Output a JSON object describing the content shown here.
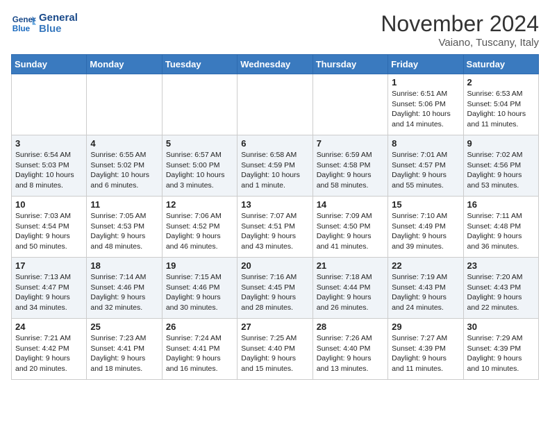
{
  "header": {
    "logo_line1": "General",
    "logo_line2": "Blue",
    "month": "November 2024",
    "location": "Vaiano, Tuscany, Italy"
  },
  "days_of_week": [
    "Sunday",
    "Monday",
    "Tuesday",
    "Wednesday",
    "Thursday",
    "Friday",
    "Saturday"
  ],
  "weeks": [
    [
      {
        "day": "",
        "info": ""
      },
      {
        "day": "",
        "info": ""
      },
      {
        "day": "",
        "info": ""
      },
      {
        "day": "",
        "info": ""
      },
      {
        "day": "",
        "info": ""
      },
      {
        "day": "1",
        "info": "Sunrise: 6:51 AM\nSunset: 5:06 PM\nDaylight: 10 hours\nand 14 minutes."
      },
      {
        "day": "2",
        "info": "Sunrise: 6:53 AM\nSunset: 5:04 PM\nDaylight: 10 hours\nand 11 minutes."
      }
    ],
    [
      {
        "day": "3",
        "info": "Sunrise: 6:54 AM\nSunset: 5:03 PM\nDaylight: 10 hours\nand 8 minutes."
      },
      {
        "day": "4",
        "info": "Sunrise: 6:55 AM\nSunset: 5:02 PM\nDaylight: 10 hours\nand 6 minutes."
      },
      {
        "day": "5",
        "info": "Sunrise: 6:57 AM\nSunset: 5:00 PM\nDaylight: 10 hours\nand 3 minutes."
      },
      {
        "day": "6",
        "info": "Sunrise: 6:58 AM\nSunset: 4:59 PM\nDaylight: 10 hours\nand 1 minute."
      },
      {
        "day": "7",
        "info": "Sunrise: 6:59 AM\nSunset: 4:58 PM\nDaylight: 9 hours\nand 58 minutes."
      },
      {
        "day": "8",
        "info": "Sunrise: 7:01 AM\nSunset: 4:57 PM\nDaylight: 9 hours\nand 55 minutes."
      },
      {
        "day": "9",
        "info": "Sunrise: 7:02 AM\nSunset: 4:56 PM\nDaylight: 9 hours\nand 53 minutes."
      }
    ],
    [
      {
        "day": "10",
        "info": "Sunrise: 7:03 AM\nSunset: 4:54 PM\nDaylight: 9 hours\nand 50 minutes."
      },
      {
        "day": "11",
        "info": "Sunrise: 7:05 AM\nSunset: 4:53 PM\nDaylight: 9 hours\nand 48 minutes."
      },
      {
        "day": "12",
        "info": "Sunrise: 7:06 AM\nSunset: 4:52 PM\nDaylight: 9 hours\nand 46 minutes."
      },
      {
        "day": "13",
        "info": "Sunrise: 7:07 AM\nSunset: 4:51 PM\nDaylight: 9 hours\nand 43 minutes."
      },
      {
        "day": "14",
        "info": "Sunrise: 7:09 AM\nSunset: 4:50 PM\nDaylight: 9 hours\nand 41 minutes."
      },
      {
        "day": "15",
        "info": "Sunrise: 7:10 AM\nSunset: 4:49 PM\nDaylight: 9 hours\nand 39 minutes."
      },
      {
        "day": "16",
        "info": "Sunrise: 7:11 AM\nSunset: 4:48 PM\nDaylight: 9 hours\nand 36 minutes."
      }
    ],
    [
      {
        "day": "17",
        "info": "Sunrise: 7:13 AM\nSunset: 4:47 PM\nDaylight: 9 hours\nand 34 minutes."
      },
      {
        "day": "18",
        "info": "Sunrise: 7:14 AM\nSunset: 4:46 PM\nDaylight: 9 hours\nand 32 minutes."
      },
      {
        "day": "19",
        "info": "Sunrise: 7:15 AM\nSunset: 4:46 PM\nDaylight: 9 hours\nand 30 minutes."
      },
      {
        "day": "20",
        "info": "Sunrise: 7:16 AM\nSunset: 4:45 PM\nDaylight: 9 hours\nand 28 minutes."
      },
      {
        "day": "21",
        "info": "Sunrise: 7:18 AM\nSunset: 4:44 PM\nDaylight: 9 hours\nand 26 minutes."
      },
      {
        "day": "22",
        "info": "Sunrise: 7:19 AM\nSunset: 4:43 PM\nDaylight: 9 hours\nand 24 minutes."
      },
      {
        "day": "23",
        "info": "Sunrise: 7:20 AM\nSunset: 4:43 PM\nDaylight: 9 hours\nand 22 minutes."
      }
    ],
    [
      {
        "day": "24",
        "info": "Sunrise: 7:21 AM\nSunset: 4:42 PM\nDaylight: 9 hours\nand 20 minutes."
      },
      {
        "day": "25",
        "info": "Sunrise: 7:23 AM\nSunset: 4:41 PM\nDaylight: 9 hours\nand 18 minutes."
      },
      {
        "day": "26",
        "info": "Sunrise: 7:24 AM\nSunset: 4:41 PM\nDaylight: 9 hours\nand 16 minutes."
      },
      {
        "day": "27",
        "info": "Sunrise: 7:25 AM\nSunset: 4:40 PM\nDaylight: 9 hours\nand 15 minutes."
      },
      {
        "day": "28",
        "info": "Sunrise: 7:26 AM\nSunset: 4:40 PM\nDaylight: 9 hours\nand 13 minutes."
      },
      {
        "day": "29",
        "info": "Sunrise: 7:27 AM\nSunset: 4:39 PM\nDaylight: 9 hours\nand 11 minutes."
      },
      {
        "day": "30",
        "info": "Sunrise: 7:29 AM\nSunset: 4:39 PM\nDaylight: 9 hours\nand 10 minutes."
      }
    ]
  ]
}
